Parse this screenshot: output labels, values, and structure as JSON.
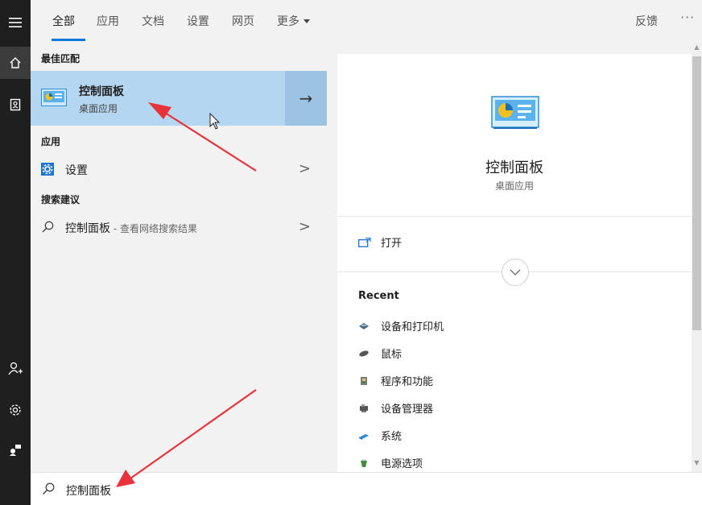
{
  "tabs": {
    "all": "全部",
    "apps": "应用",
    "docs": "文档",
    "settings": "设置",
    "web": "网页",
    "more": "更多",
    "feedback": "反馈",
    "more_options": "···"
  },
  "results": {
    "best_match_title": "最佳匹配",
    "best_match": {
      "name": "控制面板",
      "kind": "桌面应用"
    },
    "apps_title": "应用",
    "apps_item": "设置",
    "suggestions_title": "搜索建议",
    "suggestion_main": "控制面板",
    "suggestion_sub": " - 查看网络搜索结果"
  },
  "detail": {
    "name": "控制面板",
    "kind": "桌面应用",
    "open_label": "打开",
    "recent_title": "Recent",
    "recent": [
      "设备和打印机",
      "鼠标",
      "程序和功能",
      "设备管理器",
      "系统",
      "电源选项"
    ]
  },
  "search": {
    "query": "控制面板"
  },
  "colors": {
    "accent": "#0078d7",
    "selection": "#b4d6f0",
    "annotation": "#e8333a"
  },
  "icons": {
    "rail": [
      "hamburger-icon",
      "home-icon",
      "notebook-icon",
      "account-add-icon",
      "gear-icon",
      "feedback-person-icon"
    ],
    "search": "search-icon"
  }
}
